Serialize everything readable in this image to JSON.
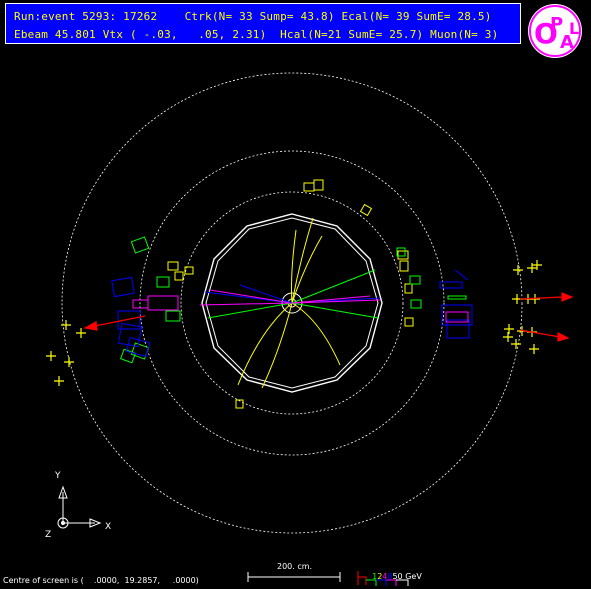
{
  "header": {
    "line1": "Run:event 5293: 17262    Ctrk(N= 33 Sump= 43.8) Ecal(N= 39 SumE= 28.5)",
    "line2": "Ebeam 45.801 Vtx ( -.03,   .05, 2.31)  Hcal(N=21 SumE= 25.7) Muon(N= 3)"
  },
  "axes": {
    "y_label": "Y",
    "x_label": "X",
    "z_label": "Z"
  },
  "scale_bar": {
    "label": "200. cm."
  },
  "energy_legend": {
    "values": [
      "1",
      "2",
      "4",
      "8",
      "50 GeV"
    ]
  },
  "footer": {
    "centre_text": "Centre of screen is (    .0000,  19.2857,     .0000)"
  },
  "colors": {
    "background": "#000000",
    "header_bg": "#0000ff",
    "header_text": "#ffff00",
    "track": "#ffff00",
    "ecal": "#ffff00",
    "hcal": "#0000ff",
    "muon": "#ff0000"
  }
}
